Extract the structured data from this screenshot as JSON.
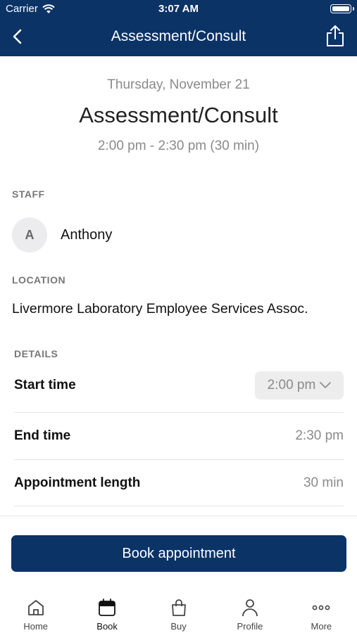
{
  "status_bar": {
    "carrier": "Carrier",
    "time": "3:07 AM"
  },
  "nav": {
    "title": "Assessment/Consult"
  },
  "appointment": {
    "date": "Thursday, November 21",
    "title": "Assessment/Consult",
    "time_range": "2:00 pm - 2:30 pm (30 min)"
  },
  "staff": {
    "label": "STAFF",
    "initial": "A",
    "name": "Anthony"
  },
  "location": {
    "label": "LOCATION",
    "name": "Livermore Laboratory Employee Services Assoc."
  },
  "details": {
    "label": "DETAILS",
    "start_time_label": "Start time",
    "start_time_value": "2:00 pm",
    "end_time_label": "End time",
    "end_time_value": "2:30 pm",
    "length_label": "Appointment length",
    "length_value": "30 min"
  },
  "book_button": {
    "label": "Book appointment"
  },
  "tabs": [
    {
      "label": "Home",
      "icon": "home-icon"
    },
    {
      "label": "Book",
      "icon": "calendar-icon"
    },
    {
      "label": "Buy",
      "icon": "shopping-bag-icon"
    },
    {
      "label": "Profile",
      "icon": "person-icon"
    },
    {
      "label": "More",
      "icon": "more-dots-icon"
    }
  ],
  "colors": {
    "brand": "#0b3366",
    "muted_text": "#8a8a8a",
    "label_text": "#777777"
  }
}
